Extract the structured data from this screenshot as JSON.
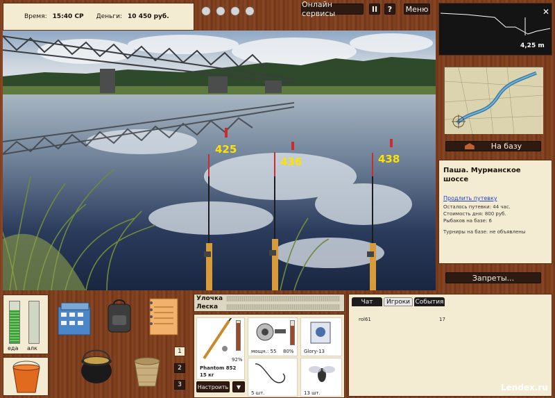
{
  "status": {
    "time_label": "Время:",
    "time_value": "15:40 СР",
    "money_label": "Деньги:",
    "money_value": "10 450 руб."
  },
  "toolbar": {
    "online_label": "Онлайн сервисы",
    "pause_label": "II",
    "help_label": "?",
    "menu_label": "Меню",
    "close_label": "✕"
  },
  "depth": {
    "value_label": "4,25 m"
  },
  "nav": {
    "base_label": "На базу"
  },
  "location": {
    "title": "Паша. Мурманское шоссе",
    "extend_link": "Продлить путевку",
    "remaining": "Осталось путевки: 44 час.",
    "day_cost": "Стоимость дня: 800 руб.",
    "fishers": "Рыбаков на базе: 6",
    "tournaments": "Турниры на базе: не объявлены"
  },
  "rods": [
    {
      "depth_label": "425"
    },
    {
      "depth_label": "436"
    },
    {
      "depth_label": "438"
    }
  ],
  "restrictions_label": "Запреты...",
  "gauges": {
    "food_label": "еда",
    "alc_label": "алк",
    "food_level": 0.8,
    "alc_level": 0
  },
  "rod_buttons": [
    "1",
    "2",
    "3"
  ],
  "tackle": {
    "catch_label": "Улочка",
    "line_label": "Леска",
    "rod_name": "Phantom 852",
    "rod_weight": "15 кг",
    "rod_percent": "92%",
    "reel_power": "мощн.: 55",
    "reel_percent": "80%",
    "bait_name": "Glory-13",
    "hook_count": "5 шт.",
    "fly_count": "13 шт.",
    "setup_label": "Настроить",
    "dropdown_icon": "▼"
  },
  "chat": {
    "tabs": [
      "Чат",
      "Игроки",
      "События"
    ],
    "active_tab": 1,
    "players": [
      {
        "name": "rol61",
        "value": "17"
      }
    ]
  },
  "watermark": "Lendex.ru",
  "colors": {
    "wood": "#7c3f1f",
    "panel": "#f3ecd2",
    "depth_text": "#ffe200"
  }
}
